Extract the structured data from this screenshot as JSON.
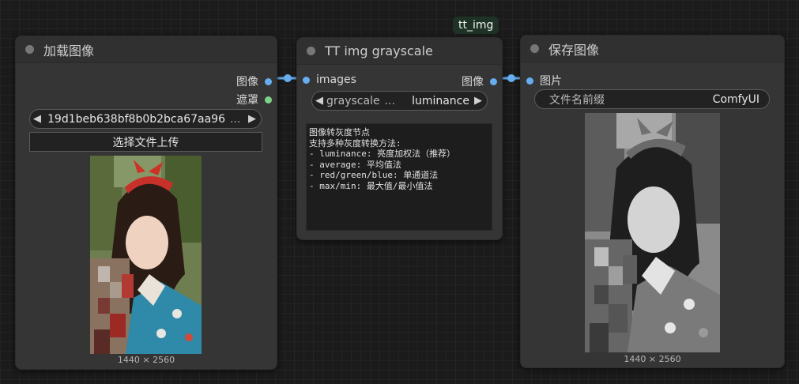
{
  "badge": {
    "label": "tt_img"
  },
  "load_node": {
    "title": "加载图像",
    "outputs": {
      "image": "图像",
      "mask": "遮罩"
    },
    "image_combo": {
      "value": "19d1beb638bf8b0b2bca67aa96",
      "ellipsis": "..."
    },
    "upload_button": "选择文件上传",
    "dimensions": "1440 × 2560"
  },
  "gray_node": {
    "title": "TT img grayscale",
    "input": "images",
    "output": "图像",
    "combo": {
      "label": "grayscale",
      "ellipsis": "...",
      "value": "luminance"
    },
    "description": "图像转灰度节点\n支持多种灰度转换方法:\n- luminance: 亮度加权法（推荐）\n- average: 平均值法\n- red/green/blue: 单通道法\n- max/min: 最大值/最小值法"
  },
  "save_node": {
    "title": "保存图像",
    "input": "图片",
    "prefix": {
      "label": "文件名前缀",
      "value": "ComfyUI"
    },
    "dimensions": "1440 × 2560"
  },
  "colors": {
    "link": "#66aef0",
    "mask_slot": "#7fd28a",
    "badge_bg": "#1e3326"
  },
  "icons": {
    "left": "◀",
    "right": "▶"
  }
}
